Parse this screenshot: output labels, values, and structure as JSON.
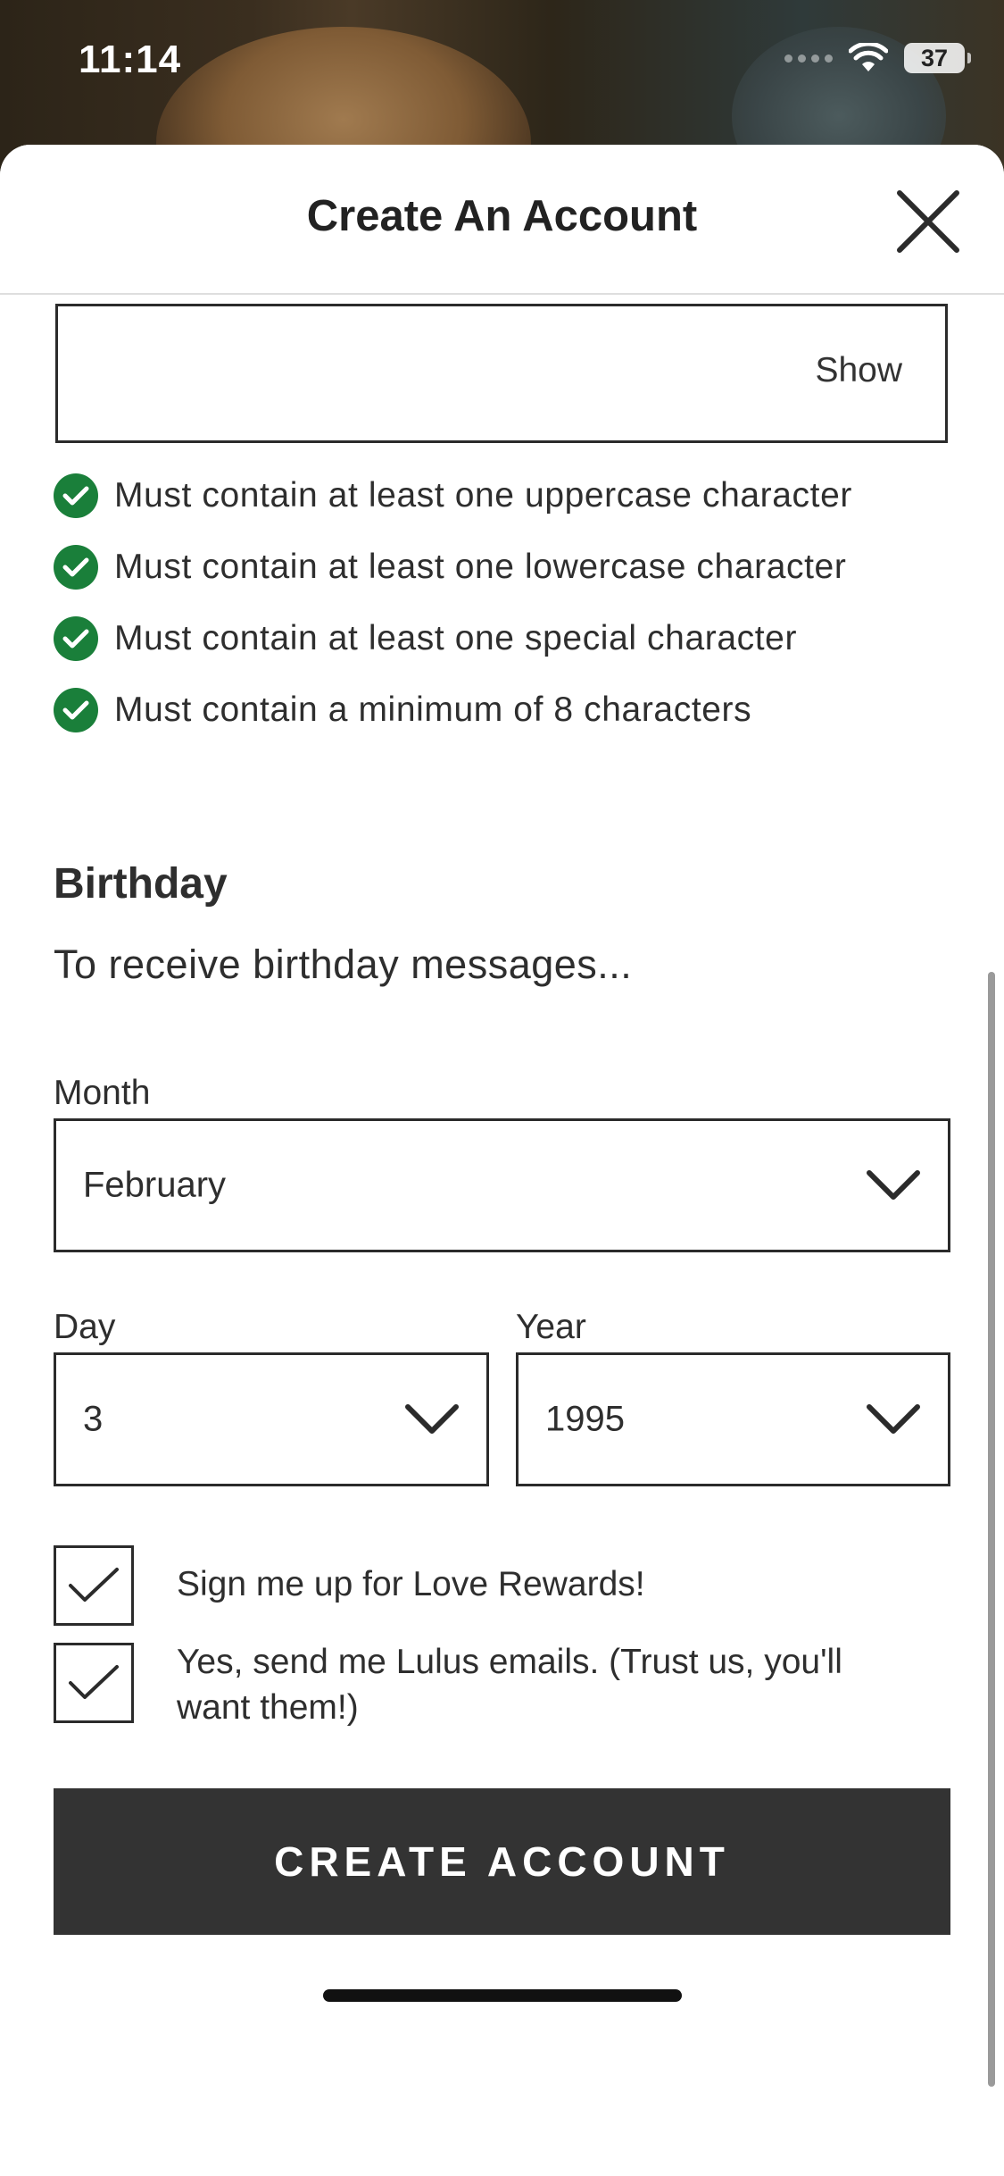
{
  "status_bar": {
    "time": "11:14",
    "battery": "37"
  },
  "header": {
    "title": "Create An Account"
  },
  "password": {
    "show_label": "Show"
  },
  "password_rules": [
    "Must contain at least one uppercase character",
    "Must contain at least one lowercase character",
    "Must contain at least one special character",
    "Must contain a minimum of 8 characters"
  ],
  "birthday": {
    "title": "Birthday",
    "subtitle": "To receive birthday messages...",
    "month_label": "Month",
    "month_value": "February",
    "day_label": "Day",
    "day_value": "3",
    "year_label": "Year",
    "year_value": "1995"
  },
  "opt_ins": {
    "rewards": {
      "label": "Sign me up for Love Rewards!",
      "checked": true
    },
    "emails": {
      "label": "Yes, send me Lulus emails. (Trust us, you'll want them!)",
      "checked": true
    }
  },
  "submit": {
    "label": "CREATE ACCOUNT"
  },
  "colors": {
    "success": "#1a7f3a",
    "button": "#333333",
    "border": "#2b2b2b"
  }
}
